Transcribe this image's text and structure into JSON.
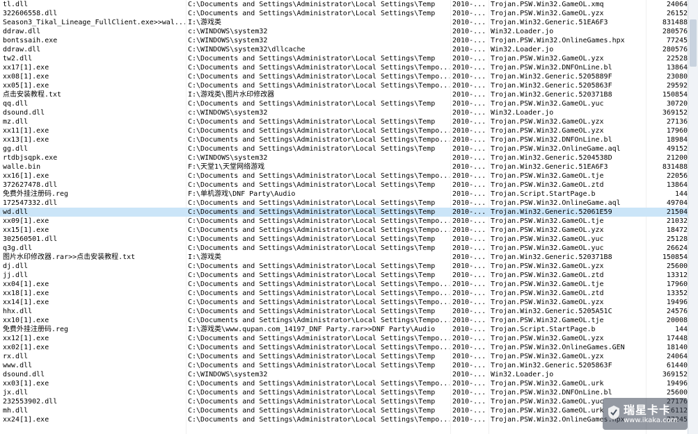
{
  "log": {
    "rows": [
      {
        "name": "tl.dll",
        "path": "C:\\Documents and Settings\\Administrator\\Local Settings\\Temp",
        "date": "2010-...",
        "virus": "Trojan.PSW.Win32.GameOL.xmq",
        "size": "24064"
      },
      {
        "name": "322606558.dll",
        "path": "C:\\Documents and Settings\\Administrator\\Local Settings\\Temp",
        "date": "2010-...",
        "virus": "Trojan.PSW.Win32.GameOL.yzx",
        "size": "26152"
      },
      {
        "name": "Season3_Tikal_Lineage_FullClient.exe>>wal...",
        "path": "I:\\游戏类",
        "date": "2010-...",
        "virus": "Trojan.Win32.Generic.51EA6F3",
        "size": "831488"
      },
      {
        "name": "ddraw.dll",
        "path": "c:\\WINDOWS\\system32",
        "date": "2010-...",
        "virus": "Win32.Loader.jo",
        "size": "280576"
      },
      {
        "name": "bontssaih.exe",
        "path": "C:\\WINDOWS\\system32",
        "date": "2010-...",
        "virus": "Trojan.PSW.Win32.OnlineGames.hpx",
        "size": "77245"
      },
      {
        "name": "ddraw.dll",
        "path": "C:\\WINDOWS\\system32\\dllcache",
        "date": "2010-...",
        "virus": "Win32.Loader.jo",
        "size": "280576"
      },
      {
        "name": "tw2.dll",
        "path": "C:\\Documents and Settings\\Administrator\\Local Settings\\Temp",
        "date": "2010-...",
        "virus": "Trojan.PSW.Win32.GameOL.yzx",
        "size": "22528"
      },
      {
        "name": "xx17[1].exe",
        "path": "C:\\Documents and Settings\\Administrator\\Local Settings\\Tempo...",
        "date": "2010-...",
        "virus": "Trojan.PSW.Win32.DNFOnLine.bl",
        "size": "13864"
      },
      {
        "name": "xx08[1].exe",
        "path": "C:\\Documents and Settings\\Administrator\\Local Settings\\Tempo...",
        "date": "2010-...",
        "virus": "Trojan.Win32.Generic.5205889F",
        "size": "23080"
      },
      {
        "name": "xx05[1].exe",
        "path": "C:\\Documents and Settings\\Administrator\\Local Settings\\Tempo...",
        "date": "2010-...",
        "virus": "Trojan.Win32.Generic.5205863F",
        "size": "29592"
      },
      {
        "name": "点击安装教程.txt",
        "path": "I:\\游戏类\\图片水印修改器",
        "date": "2010-...",
        "virus": "Trojan.Win32.Generic.520371B8",
        "size": "150854"
      },
      {
        "name": "qq.dll",
        "path": "C:\\Documents and Settings\\Administrator\\Local Settings\\Temp",
        "date": "2010-...",
        "virus": "Trojan.PSW.Win32.GameOL.yuc",
        "size": "30720"
      },
      {
        "name": "dsound.dll",
        "path": "c:\\WINDOWS\\system32",
        "date": "2010-...",
        "virus": "Win32.Loader.jo",
        "size": "369152"
      },
      {
        "name": "mz.dll",
        "path": "C:\\Documents and Settings\\Administrator\\Local Settings\\Temp",
        "date": "2010-...",
        "virus": "Trojan.PSW.Win32.GameOL.yzx",
        "size": "27136"
      },
      {
        "name": "xx11[1].exe",
        "path": "C:\\Documents and Settings\\Administrator\\Local Settings\\Tempo...",
        "date": "2010-...",
        "virus": "Trojan.PSW.Win32.GameOL.yzx",
        "size": "17960"
      },
      {
        "name": "xx13[1].exe",
        "path": "C:\\Documents and Settings\\Administrator\\Local Settings\\Tempo...",
        "date": "2010-...",
        "virus": "Trojan.PSW.Win32.DNFOnLine.bl",
        "size": "18984"
      },
      {
        "name": "gg.dll",
        "path": "C:\\Documents and Settings\\Administrator\\Local Settings\\Temp",
        "date": "2010-...",
        "virus": "Trojan.PSW.Win32.OnlineGame.aql",
        "size": "49152"
      },
      {
        "name": "rtdbjsqpk.exe",
        "path": "C:\\WINDOWS\\system32",
        "date": "2010-...",
        "virus": "Trojan.Win32.Generic.5204538D",
        "size": "21200"
      },
      {
        "name": "walle.bin",
        "path": "F:\\天堂1\\天堂网络游戏",
        "date": "2010-...",
        "virus": "Trojan.Win32.Generic.51EA6F3",
        "size": "831488"
      },
      {
        "name": "xx16[1].exe",
        "path": "C:\\Documents and Settings\\Administrator\\Local Settings\\Tempo...",
        "date": "2010-...",
        "virus": "Trojan.PSW.Win32.GameOL.tje",
        "size": "22056"
      },
      {
        "name": "372627478.dll",
        "path": "C:\\Documents and Settings\\Administrator\\Local Settings\\Temp",
        "date": "2010-...",
        "virus": "Trojan.PSW.Win32.GameOL.ztd",
        "size": "13864"
      },
      {
        "name": "免费外挂注册码.reg",
        "path": "F:\\单机游戏\\DNF Party\\Audio",
        "date": "2010-...",
        "virus": "Trojan.Script.StartPage.b",
        "size": "144"
      },
      {
        "name": "172547332.dll",
        "path": "C:\\Documents and Settings\\Administrator\\Local Settings\\Temp",
        "date": "2010-...",
        "virus": "Trojan.PSW.Win32.OnlineGame.aql",
        "size": "49704"
      },
      {
        "name": "wd.dll",
        "path": "C:\\Documents and Settings\\Administrator\\Local Settings\\Temp",
        "date": "2010-...",
        "virus": "Trojan.Win32.Generic.52061E59",
        "size": "21504",
        "selected": true
      },
      {
        "name": "xx09[1].exe",
        "path": "C:\\Documents and Settings\\Administrator\\Local Settings\\Tempo...",
        "date": "2010-...",
        "virus": "Trojan.PSW.Win32.GameOL.tje",
        "size": "21032"
      },
      {
        "name": "xx15[1].exe",
        "path": "C:\\Documents and Settings\\Administrator\\Local Settings\\Tempo...",
        "date": "2010-...",
        "virus": "Trojan.PSW.Win32.GameOL.yzx",
        "size": "18472"
      },
      {
        "name": "302560501.dll",
        "path": "C:\\Documents and Settings\\Administrator\\Local Settings\\Temp",
        "date": "2010-...",
        "virus": "Trojan.PSW.Win32.GameOL.yuc",
        "size": "25128"
      },
      {
        "name": "q3g.dll",
        "path": "C:\\Documents and Settings\\Administrator\\Local Settings\\Temp",
        "date": "2010-...",
        "virus": "Trojan.PSW.Win32.GameOL.yuc",
        "size": "26624"
      },
      {
        "name": "图片水印修改器.rar>>点击安装教程.txt",
        "path": "I:\\游戏类",
        "date": "2010-...",
        "virus": "Trojan.Win32.Generic.520371B8",
        "size": "150854"
      },
      {
        "name": "dj.dll",
        "path": "C:\\Documents and Settings\\Administrator\\Local Settings\\Temp",
        "date": "2010-...",
        "virus": "Trojan.PSW.Win32.GameOL.yzx",
        "size": "25600"
      },
      {
        "name": "jj.dll",
        "path": "C:\\Documents and Settings\\Administrator\\Local Settings\\Temp",
        "date": "2010-...",
        "virus": "Trojan.PSW.Win32.GameOL.ztd",
        "size": "13312"
      },
      {
        "name": "xx04[1].exe",
        "path": "C:\\Documents and Settings\\Administrator\\Local Settings\\Tempo...",
        "date": "2010-...",
        "virus": "Trojan.PSW.Win32.GameOL.tje",
        "size": "17960"
      },
      {
        "name": "xx18[1].exe",
        "path": "C:\\Documents and Settings\\Administrator\\Local Settings\\Tempo...",
        "date": "2010-...",
        "virus": "Trojan.PSW.Win32.GameOL.ztd",
        "size": "13352"
      },
      {
        "name": "xx14[1].exe",
        "path": "C:\\Documents and Settings\\Administrator\\Local Settings\\Tempo...",
        "date": "2010-...",
        "virus": "Trojan.PSW.Win32.GameOL.yzx",
        "size": "19496"
      },
      {
        "name": "hhx.dll",
        "path": "C:\\Documents and Settings\\Administrator\\Local Settings\\Temp",
        "date": "2010-...",
        "virus": "Trojan.Win32.Generic.5205A51C",
        "size": "24576"
      },
      {
        "name": "xx10[1].exe",
        "path": "C:\\Documents and Settings\\Administrator\\Local Settings\\Tempo...",
        "date": "2010-...",
        "virus": "Trojan.PSW.Win32.GameOL.tje",
        "size": "20008"
      },
      {
        "name": "免费外挂注册码.reg",
        "path": "I:\\游戏类\\www.qupan.com_14197_DNF Party.rar>>DNF Party\\Audio",
        "date": "2010-...",
        "virus": "Trojan.Script.StartPage.b",
        "size": "144"
      },
      {
        "name": "xx12[1].exe",
        "path": "C:\\Documents and Settings\\Administrator\\Local Settings\\Tempo...",
        "date": "2010-...",
        "virus": "Trojan.PSW.Win32.GameOL.yzx",
        "size": "17448"
      },
      {
        "name": "xx02[1].exe",
        "path": "C:\\Documents and Settings\\Administrator\\Local Settings\\Tempo...",
        "date": "2010-...",
        "virus": "Trojan.PSW.Win32.OnlineGames.GEN",
        "size": "18140"
      },
      {
        "name": "rx.dll",
        "path": "C:\\Documents and Settings\\Administrator\\Local Settings\\Temp",
        "date": "2010-...",
        "virus": "Trojan.PSW.Win32.GameOL.yzx",
        "size": "24064"
      },
      {
        "name": "www.dll",
        "path": "C:\\Documents and Settings\\Administrator\\Local Settings\\Temp",
        "date": "2010-...",
        "virus": "Trojan.Win32.Generic.5205863F",
        "size": "61440"
      },
      {
        "name": "dsound.dll",
        "path": "C:\\WINDOWS\\system32",
        "date": "2010-...",
        "virus": "Win32.Loader.jo",
        "size": "369152"
      },
      {
        "name": "xx03[1].exe",
        "path": "C:\\Documents and Settings\\Administrator\\Local Settings\\Tempo...",
        "date": "2010-...",
        "virus": "Trojan.PSW.Win32.GameOL.urk",
        "size": "19496"
      },
      {
        "name": "jx.dll",
        "path": "C:\\Documents and Settings\\Administrator\\Local Settings\\Temp",
        "date": "2010-...",
        "virus": "Trojan.PSW.Win32.DNFOnLine.bl",
        "size": "25600"
      },
      {
        "name": "232553902.dll",
        "path": "C:\\Documents and Settings\\Administrator\\Local Settings\\Temp",
        "date": "2010-...",
        "virus": "Trojan.PSW.Win32.GameOL.yuc",
        "size": "27176"
      },
      {
        "name": "mh.dll",
        "path": "C:\\Documents and Settings\\Administrator\\Local Settings\\Temp",
        "date": "2010-...",
        "virus": "Trojan.PSW.Win32.GameOL.urk",
        "size": "26112"
      },
      {
        "name": "xx24[1].exe",
        "path": "C:\\Documents and Settings\\Administrator\\Local Settings\\Tempo...",
        "date": "2010-...",
        "virus": "Trojan.PSW.Win32.OnlineGames.hpx",
        "size": "77245"
      }
    ]
  },
  "watermark": {
    "title": "瑞星卡卡",
    "url": "www.ikaka.com"
  },
  "colors": {
    "selected_row": "#cbe5f8",
    "scrollbar_track": "#f0f3f7",
    "scrollbar_thumb": "#c9d3df"
  }
}
